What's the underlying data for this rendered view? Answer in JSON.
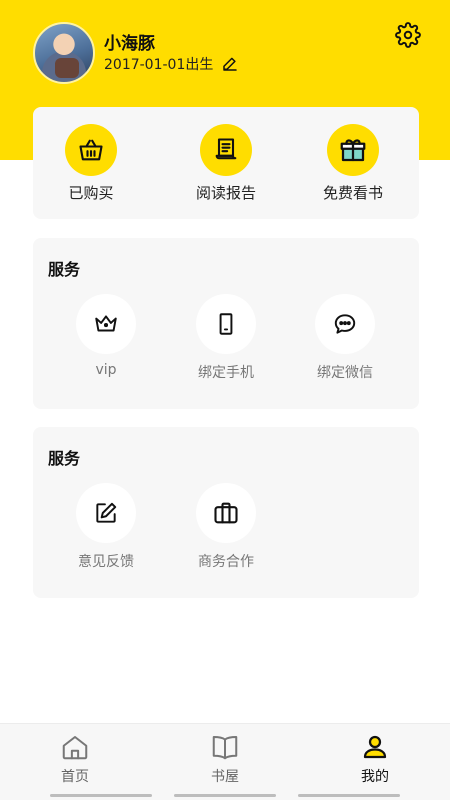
{
  "profile": {
    "name": "小海豚",
    "birth_text": "2017-01-01出生"
  },
  "quick_actions": [
    {
      "label": "已购买",
      "icon": "basket-icon"
    },
    {
      "label": "阅读报告",
      "icon": "report-icon"
    },
    {
      "label": "免费看书",
      "icon": "gift-icon"
    }
  ],
  "sections": [
    {
      "title": "服务",
      "items": [
        {
          "label": "vip",
          "icon": "crown-icon"
        },
        {
          "label": "绑定手机",
          "icon": "phone-icon"
        },
        {
          "label": "绑定微信",
          "icon": "chat-icon"
        }
      ]
    },
    {
      "title": "服务",
      "items": [
        {
          "label": "意见反馈",
          "icon": "edit-icon"
        },
        {
          "label": "商务合作",
          "icon": "briefcase-icon"
        }
      ]
    }
  ],
  "tabbar": {
    "tabs": [
      {
        "label": "首页",
        "icon": "home-icon"
      },
      {
        "label": "书屋",
        "icon": "book-icon"
      },
      {
        "label": "我的",
        "icon": "user-icon",
        "active": true
      }
    ]
  },
  "colors": {
    "accent": "#FFDD00",
    "card_bg": "#F7F7F7",
    "muted_text": "#777777"
  }
}
